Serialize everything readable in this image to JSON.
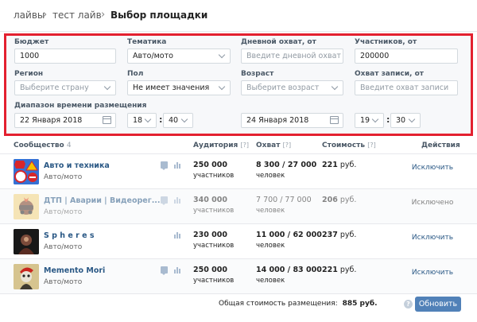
{
  "breadcrumbs": [
    "лайвы",
    "тест лайв",
    "Выбор площадки"
  ],
  "filters": {
    "budget": {
      "label": "Бюджет",
      "value": "1000"
    },
    "theme": {
      "label": "Тематика",
      "value": "Авто/мото"
    },
    "daily_reach": {
      "label": "Дневной охват, от",
      "placeholder": "Введите дневной охват"
    },
    "members": {
      "label": "Участников, от",
      "value": "200000"
    },
    "region": {
      "label": "Регион",
      "placeholder": "Выберите страну"
    },
    "gender": {
      "label": "Пол",
      "value": "Не имеет значения"
    },
    "age": {
      "label": "Возраст",
      "placeholder": "Выберите возраст"
    },
    "post_reach": {
      "label": "Охват записи, от",
      "placeholder": "Введите охват записи"
    },
    "time_range": {
      "label": "Диапазон времени размещения",
      "from_date": "22 Января 2018",
      "from_hour": "18",
      "from_min": "40",
      "to_date": "24 Января 2018",
      "to_hour": "19",
      "to_min": "30",
      "colon": ":"
    }
  },
  "table": {
    "headers": {
      "community": "Сообщество",
      "community_count": "4",
      "audience": "Аудитория",
      "reach": "Охват",
      "cost": "Стоимость",
      "help": "[?]",
      "actions": "Действия"
    },
    "rows": [
      {
        "name": "Авто и техника",
        "category": "Авто/мото",
        "audience": "250 000",
        "audience_unit": "участников",
        "reach": "8 300 / 27 000",
        "reach_unit": "человек",
        "cost": "221",
        "cost_unit": "руб.",
        "action": "Исключить"
      },
      {
        "name": "ДТП | Аварии | Видеорег...",
        "category": "Авто/мото",
        "audience": "340 000",
        "audience_unit": "участников",
        "reach": "7 700 / 77 000",
        "reach_unit": "человек",
        "cost": "206",
        "cost_unit": "руб.",
        "action": "Исключено"
      },
      {
        "name": "S p h e r e s",
        "category": "Авто/мото",
        "audience": "230 000",
        "audience_unit": "участников",
        "reach": "11 000 / 62 000",
        "reach_unit": "человек",
        "cost": "237",
        "cost_unit": "руб.",
        "action": "Исключить"
      },
      {
        "name": "Memento Mori",
        "category": "Авто/мото",
        "audience": "250 000",
        "audience_unit": "участников",
        "reach": "14 000 / 83 000",
        "reach_unit": "человек",
        "cost": "221",
        "cost_unit": "руб.",
        "action": "Исключить"
      }
    ]
  },
  "footer": {
    "total_label": "Общая стоимость размещения:",
    "total_value": "885 руб.",
    "help": "?",
    "update_button": "Обновить"
  },
  "colors": {
    "accent": "#5181b8",
    "highlight_border": "#e3202f",
    "link": "#2a5885"
  }
}
